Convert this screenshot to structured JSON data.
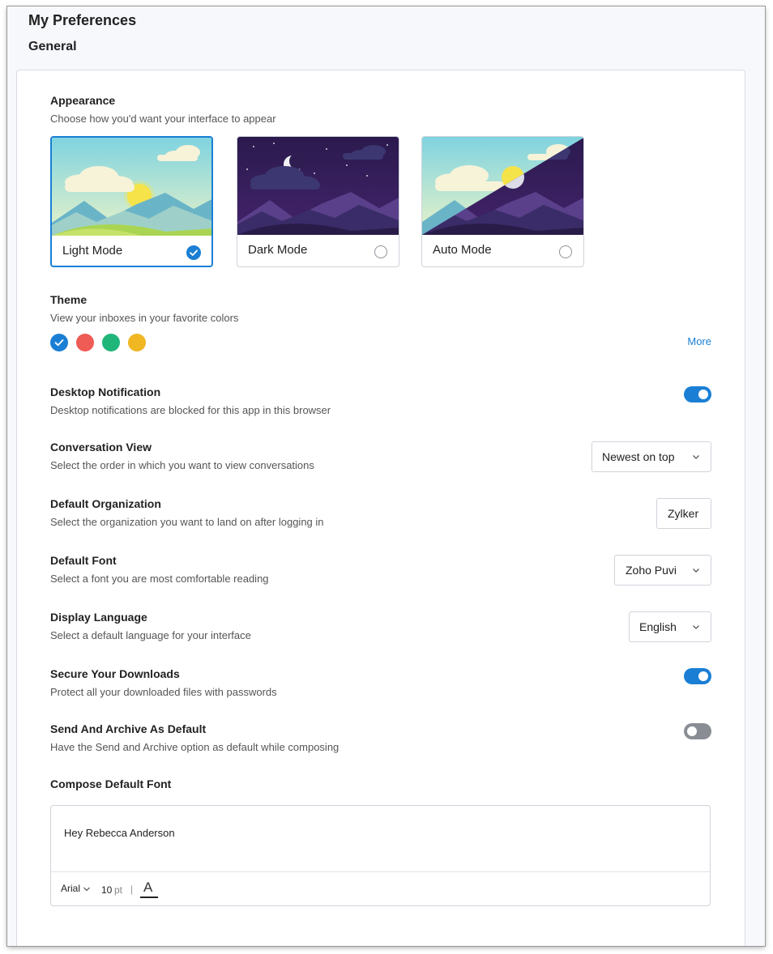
{
  "header": {
    "title": "My Preferences",
    "section": "General"
  },
  "appearance": {
    "title": "Appearance",
    "description": "Choose how you'd want your interface to appear",
    "modes": [
      {
        "label": "Light Mode",
        "selected": true
      },
      {
        "label": "Dark Mode",
        "selected": false
      },
      {
        "label": "Auto Mode",
        "selected": false
      }
    ]
  },
  "theme": {
    "title": "Theme",
    "description": "View your inboxes in your favorite colors",
    "swatches": [
      "#1a7fd4",
      "#ef5b55",
      "#20b67a",
      "#f0b723"
    ],
    "selected_index": 0,
    "more_label": "More"
  },
  "settings": {
    "desktop_notification": {
      "title": "Desktop Notification",
      "description": "Desktop notifications are blocked for this app in this browser",
      "enabled": true
    },
    "conversation_view": {
      "title": "Conversation View",
      "description": "Select the order in which you want to view conversations",
      "value": "Newest on top"
    },
    "default_organization": {
      "title": "Default Organization",
      "description": "Select the organization you want to land on after logging in",
      "value": "Zylker"
    },
    "default_font": {
      "title": "Default Font",
      "description": "Select a font you are most comfortable reading",
      "value": "Zoho Puvi"
    },
    "display_language": {
      "title": "Display Language",
      "description": "Select a default language for your interface",
      "value": "English"
    },
    "secure_downloads": {
      "title": "Secure Your Downloads",
      "description": "Protect all your downloaded files with passwords",
      "enabled": true
    },
    "send_and_archive": {
      "title": "Send And Archive As Default",
      "description": "Have the Send and Archive option as default while composing",
      "enabled": false
    }
  },
  "compose": {
    "title": "Compose Default Font",
    "preview_text": "Hey Rebecca Anderson",
    "font_name": "Arial",
    "font_size": "10",
    "font_unit": "pt",
    "separator": "|",
    "font_color_glyph": "A"
  },
  "colors": {
    "accent": "#1a7fd4",
    "toggle_off": "#8a8d93"
  }
}
